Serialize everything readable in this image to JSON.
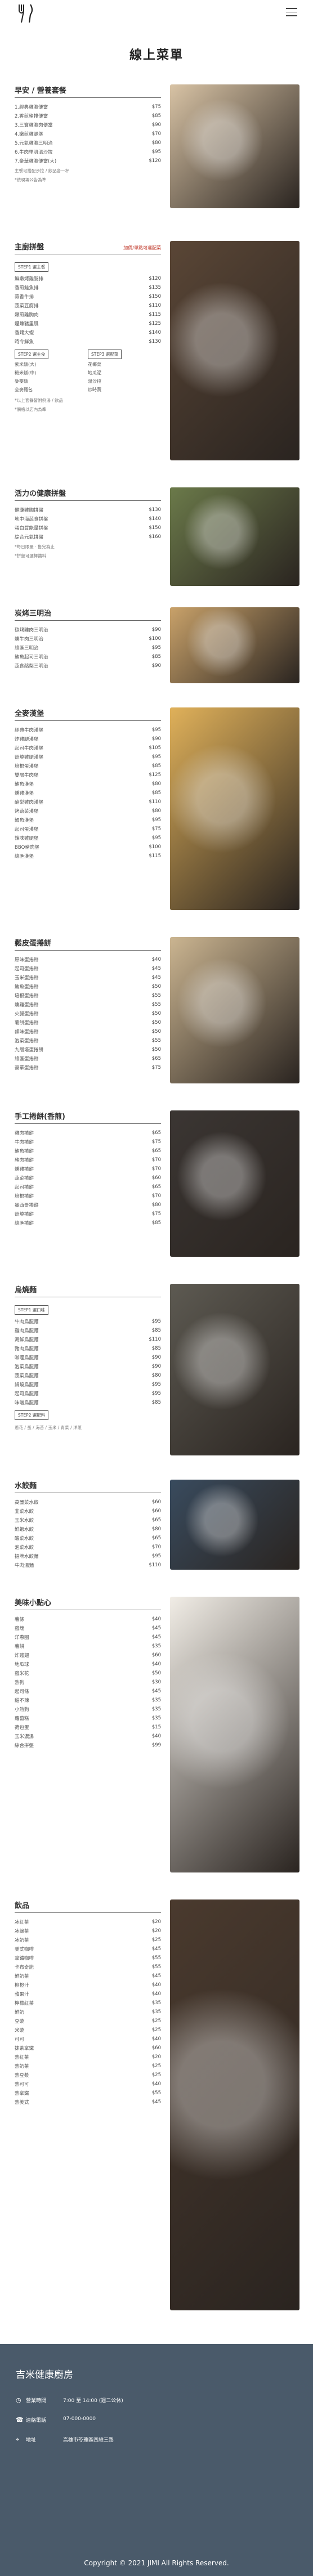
{
  "header": {
    "title": "線上菜單",
    "menu_icon": "hamburger-icon",
    "logo_icon": "fork-knife-icon"
  },
  "sections": [
    {
      "title": "早安 / 營養套餐",
      "note": "",
      "items": [
        [
          "1.經典雞胸便當",
          "$75"
        ],
        [
          "2.香煎豬排便當",
          "$85"
        ],
        [
          "3.三寶雞胸肉便當",
          "$90"
        ],
        [
          "4.嫩煎雞腿堡",
          "$70"
        ],
        [
          "5.元氣雞胸三明治",
          "$80"
        ],
        [
          "6.牛肉里肌溫沙拉",
          "$95"
        ],
        [
          "7.豪華雞胸便當(大)",
          "$120"
        ]
      ],
      "footnote": "主餐可搭配沙拉 / 飲品各一杯",
      "footnote2": "*依現場公告為準"
    },
    {
      "title": "主廚拼盤",
      "note": "加價/單點可選配菜",
      "tag": "STEP1 選主餐",
      "items": [
        [
          "鮮嫩烤雞腿排",
          "$120"
        ],
        [
          "香煎鮭魚排",
          "$135"
        ],
        [
          "蒜香牛排",
          "$150"
        ],
        [
          "蔬菜豆腐排",
          "$110"
        ],
        [
          "嫩煎雞胸肉",
          "$115"
        ],
        [
          "煙燻豬里肌",
          "$125"
        ],
        [
          "香烤大蝦",
          "$140"
        ],
        [
          "時令鮮魚",
          "$130"
        ]
      ],
      "tag2": "STEP2 選主食",
      "tag3": "STEP3 選配菜",
      "col1": [
        "紫米飯(大)",
        "糙米飯(中)",
        "藜麥飯",
        "全麥麵包"
      ],
      "col2": [
        "花椰菜",
        "地瓜泥",
        "溫沙拉",
        "炒時蔬"
      ],
      "footnote": "*以上套餐皆附例湯 / 飲品",
      "footnote2": "*價格以店內為準"
    },
    {
      "title": "活力の健康拼盤",
      "note": "",
      "items": [
        [
          "健康雞胸拼盤",
          "$130"
        ],
        [
          "地中海蔬食拼盤",
          "$140"
        ],
        [
          "蛋白質能量拼盤",
          "$150"
        ],
        [
          "綜合元氣拼盤",
          "$160"
        ]
      ],
      "footnote": "*每日限量 · 售完為止",
      "footnote2": "*拼盤可選擇醬料"
    },
    {
      "title": "炭烤三明治",
      "note": "",
      "items": [
        [
          "碳烤雞肉三明治",
          "$90"
        ],
        [
          "燻牛肉三明治",
          "$100"
        ],
        [
          "總匯三明治",
          "$95"
        ],
        [
          "鮪魚起司三明治",
          "$85"
        ],
        [
          "蔬食酪梨三明治",
          "$90"
        ]
      ]
    },
    {
      "title": "全麥漢堡",
      "note": "",
      "items": [
        [
          "經典牛肉漢堡",
          "$95"
        ],
        [
          "炸雞腿漢堡",
          "$90"
        ],
        [
          "起司牛肉漢堡",
          "$105"
        ],
        [
          "照燒雞腿漢堡",
          "$95"
        ],
        [
          "培根蛋漢堡",
          "$85"
        ],
        [
          "雙層牛肉堡",
          "$125"
        ],
        [
          "鮪魚漢堡",
          "$80"
        ],
        [
          "燻雞漢堡",
          "$85"
        ],
        [
          "酪梨雞肉漢堡",
          "$110"
        ],
        [
          "烤蔬菜漢堡",
          "$80"
        ],
        [
          "鱈魚漢堡",
          "$95"
        ],
        [
          "起司蛋漢堡",
          "$75"
        ],
        [
          "辣味雞腿堡",
          "$95"
        ],
        [
          "BBQ豬肉堡",
          "$100"
        ],
        [
          "總匯漢堡",
          "$115"
        ]
      ]
    },
    {
      "title": "鬆皮蛋捲餅",
      "note": "",
      "items": [
        [
          "原味蛋捲餅",
          "$40"
        ],
        [
          "起司蛋捲餅",
          "$45"
        ],
        [
          "玉米蛋捲餅",
          "$45"
        ],
        [
          "鮪魚蛋捲餅",
          "$50"
        ],
        [
          "培根蛋捲餅",
          "$55"
        ],
        [
          "燻雞蛋捲餅",
          "$55"
        ],
        [
          "火腿蛋捲餅",
          "$50"
        ],
        [
          "薯餅蛋捲餅",
          "$50"
        ],
        [
          "辣味蛋捲餅",
          "$50"
        ],
        [
          "泡菜蛋捲餅",
          "$55"
        ],
        [
          "九層塔蛋捲餅",
          "$50"
        ],
        [
          "總匯蛋捲餅",
          "$65"
        ],
        [
          "豪華蛋捲餅",
          "$75"
        ]
      ]
    },
    {
      "title": "手工捲餅(香煎)",
      "note": "",
      "items": [
        [
          "雞肉捲餅",
          "$65"
        ],
        [
          "牛肉捲餅",
          "$75"
        ],
        [
          "鮪魚捲餅",
          "$65"
        ],
        [
          "豬肉捲餅",
          "$70"
        ],
        [
          "燻雞捲餅",
          "$70"
        ],
        [
          "蔬菜捲餅",
          "$60"
        ],
        [
          "起司捲餅",
          "$65"
        ],
        [
          "培根捲餅",
          "$70"
        ],
        [
          "墨西哥捲餅",
          "$80"
        ],
        [
          "照燒捲餅",
          "$75"
        ],
        [
          "總匯捲餅",
          "$85"
        ]
      ]
    },
    {
      "title": "烏燒麵",
      "note": "",
      "tag": "STEP1 選口味",
      "items": [
        [
          "牛肉烏龍麵",
          "$95"
        ],
        [
          "雞肉烏龍麵",
          "$85"
        ],
        [
          "海鮮烏龍麵",
          "$110"
        ],
        [
          "豬肉烏龍麵",
          "$85"
        ],
        [
          "咖哩烏龍麵",
          "$90"
        ],
        [
          "泡菜烏龍麵",
          "$90"
        ],
        [
          "蔬菜烏龍麵",
          "$80"
        ],
        [
          "鍋燒烏龍麵",
          "$95"
        ],
        [
          "起司烏龍麵",
          "$95"
        ],
        [
          "味噌烏龍麵",
          "$85"
        ]
      ],
      "tag2": "STEP2 選配料",
      "extras": "蔥花 / 蛋 / 海苔 / 玉米 / 青菜 / 洋蔥"
    },
    {
      "title": "水餃麵",
      "note": "",
      "items": [
        [
          "高麗菜水餃",
          "$60"
        ],
        [
          "韭菜水餃",
          "$60"
        ],
        [
          "玉米水餃",
          "$65"
        ],
        [
          "鮮蝦水餃",
          "$80"
        ],
        [
          "酸菜水餃",
          "$65"
        ],
        [
          "泡菜水餃",
          "$70"
        ],
        [
          "招牌水餃麵",
          "$95"
        ],
        [
          "牛肉湯麵",
          "$110"
        ]
      ]
    },
    {
      "title": "美味小點心",
      "note": "",
      "items": [
        [
          "薯條",
          "$40"
        ],
        [
          "雞塊",
          "$45"
        ],
        [
          "洋蔥圈",
          "$45"
        ],
        [
          "薯餅",
          "$35"
        ],
        [
          "炸雞翅",
          "$60"
        ],
        [
          "地瓜球",
          "$40"
        ],
        [
          "雞米花",
          "$50"
        ],
        [
          "熱狗",
          "$30"
        ],
        [
          "起司條",
          "$45"
        ],
        [
          "甜不辣",
          "$35"
        ],
        [
          "小熱狗",
          "$35"
        ],
        [
          "蘿蔔糕",
          "$35"
        ],
        [
          "荷包蛋",
          "$15"
        ],
        [
          "玉米濃湯",
          "$40"
        ],
        [
          "綜合拼盤",
          "$99"
        ]
      ]
    },
    {
      "title": "飲品",
      "note": "",
      "items": [
        [
          "冰紅茶",
          "$20"
        ],
        [
          "冰綠茶",
          "$20"
        ],
        [
          "冰奶茶",
          "$25"
        ],
        [
          "美式咖啡",
          "$45"
        ],
        [
          "拿鐵咖啡",
          "$55"
        ],
        [
          "卡布奇諾",
          "$55"
        ],
        [
          "鮮奶茶",
          "$45"
        ],
        [
          "柳橙汁",
          "$40"
        ],
        [
          "蘋果汁",
          "$40"
        ],
        [
          "檸檬紅茶",
          "$35"
        ],
        [
          "鮮奶",
          "$35"
        ],
        [
          "豆漿",
          "$25"
        ],
        [
          "米漿",
          "$25"
        ],
        [
          "可可",
          "$40"
        ],
        [
          "抹茶拿鐵",
          "$60"
        ],
        [
          "熱紅茶",
          "$20"
        ],
        [
          "熱奶茶",
          "$25"
        ],
        [
          "熱豆漿",
          "$25"
        ],
        [
          "熱可可",
          "$40"
        ],
        [
          "熱拿鐵",
          "$55"
        ],
        [
          "熱美式",
          "$45"
        ]
      ]
    }
  ],
  "footer": {
    "title": "吉米健康廚房",
    "hours_label": "營業時間",
    "hours_value": "7:00 至 14:00 (週二公休)",
    "phone_label": "連絡電話",
    "phone_value": "07-000-0000",
    "address_label": "地址",
    "address_value": "高雄市苓雅區四維三路",
    "copyright": "Copyright © 2021 JIMI All Rights Reserved."
  }
}
